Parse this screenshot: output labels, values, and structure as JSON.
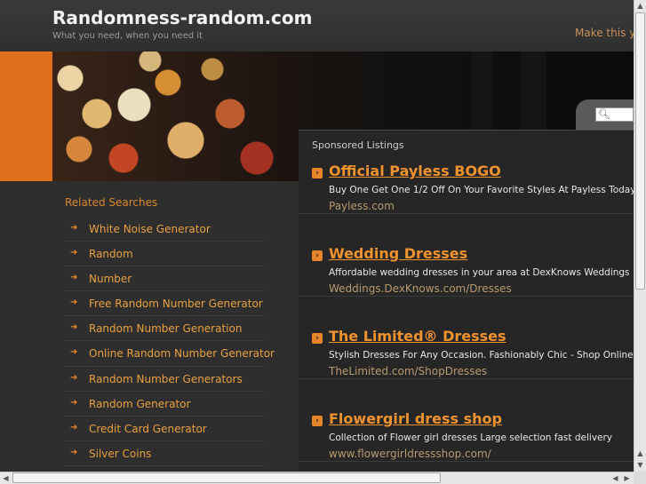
{
  "header": {
    "site_title": "Randomness-random.com",
    "tagline": "What you need, when you need it",
    "make_this": "Make this your"
  },
  "search": {
    "placeholder": ""
  },
  "related": {
    "title": "Related Searches",
    "items": [
      "White Noise Generator",
      "Random",
      "Number",
      "Free Random Number Generator",
      "Random Number Generation",
      "Online Random Number Generator",
      "Random Number Generators",
      "Random Generator",
      "Credit Card Generator",
      "Silver Coins"
    ]
  },
  "sponsored": {
    "title": "Sponsored Listings",
    "listings": [
      {
        "title": "Official Payless BOGO",
        "description": "Buy One Get One 1/2 Off On Your Favorite Styles At Payless Today",
        "url": "Payless.com"
      },
      {
        "title": "Wedding Dresses",
        "description": "Affordable wedding dresses in your area at DexKnows Weddings",
        "url": "Weddings.DexKnows.com/Dresses"
      },
      {
        "title": "The Limited® Dresses",
        "description": "Stylish Dresses For Any Occasion. Fashionably Chic - Shop Online",
        "url": "TheLimited.com/ShopDresses"
      },
      {
        "title": "Flowergirl dress shop",
        "description": "Collection of Flower girl dresses Large selection fast delivery",
        "url": "www.flowergirldressshop.com/"
      }
    ]
  },
  "colors": {
    "accent": "#e8842a",
    "background": "#2b2b2b"
  }
}
